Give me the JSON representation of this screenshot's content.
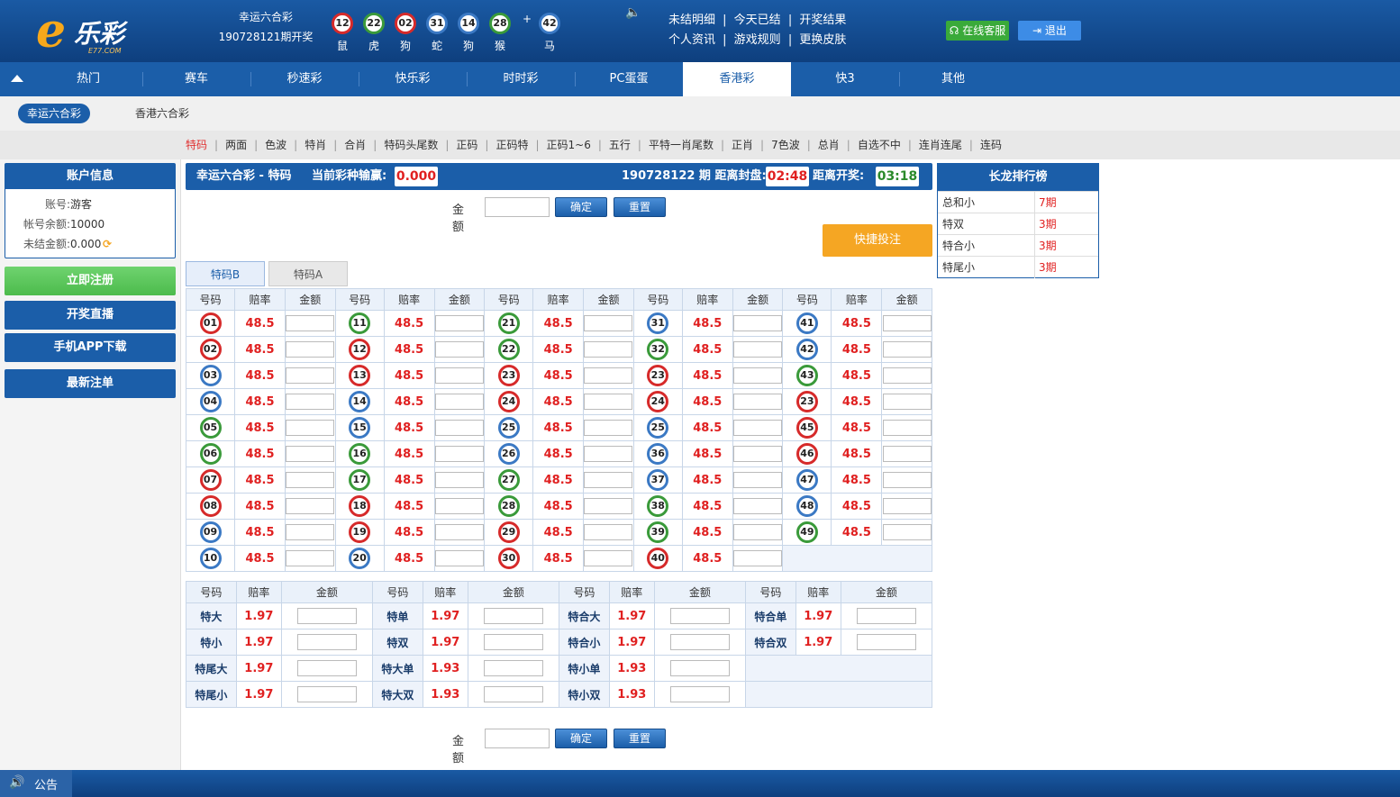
{
  "header": {
    "logo_e": "e",
    "logo_text": "乐彩",
    "logo_sub": "E77.COM",
    "lottery_name": "幸运六合彩",
    "period_text": "190728121期开奖",
    "draw": [
      {
        "num": "12",
        "zodiac": "鼠",
        "color": "red"
      },
      {
        "num": "22",
        "zodiac": "虎",
        "color": "green"
      },
      {
        "num": "02",
        "zodiac": "狗",
        "color": "red"
      },
      {
        "num": "31",
        "zodiac": "蛇",
        "color": "blue"
      },
      {
        "num": "14",
        "zodiac": "狗",
        "color": "blue"
      },
      {
        "num": "28",
        "zodiac": "猴",
        "color": "green"
      },
      {
        "num": "42",
        "zodiac": "马",
        "color": "blue"
      }
    ],
    "plus": "+",
    "links_row1": [
      "未结明细",
      "今天已结",
      "开奖结果"
    ],
    "links_row2": [
      "个人资讯",
      "游戏规则",
      "更换皮肤"
    ],
    "service_btn": "在线客服",
    "logout_btn": "退出"
  },
  "nav": {
    "items": [
      "热门",
      "赛车",
      "秒速彩",
      "快乐彩",
      "时时彩",
      "PC蛋蛋",
      "香港彩",
      "快3",
      "其他"
    ],
    "active": 6
  },
  "subtabs": [
    "幸运六合彩",
    "香港六合彩"
  ],
  "bet_types": [
    "特码",
    "两面",
    "色波",
    "特肖",
    "合肖",
    "特码头尾数",
    "正码",
    "正码特",
    "正码1~6",
    "五行",
    "平特一肖尾数",
    "正肖",
    "7色波",
    "总肖",
    "自选不中",
    "连肖连尾",
    "连码"
  ],
  "account": {
    "title": "账户信息",
    "rows": [
      {
        "k": "账号:",
        "v": "游客"
      },
      {
        "k": "帐号余额:",
        "v": "10000"
      },
      {
        "k": "未结金额:",
        "v": "0.000"
      }
    ]
  },
  "left_buttons": [
    "立即注册",
    "开奖直播",
    "手机APP下载",
    "最新注单"
  ],
  "main": {
    "title": "幸运六合彩 - 特码",
    "pl_label": "当前彩种输赢:",
    "pl_value": "0.000",
    "period": "190728122 期 距离封盘:",
    "close_time": "02:48",
    "open_label": "距离开奖:",
    "open_time": "03:18",
    "amount_label": "金额",
    "confirm": "确定",
    "reset": "重置",
    "quick_bet": "快捷投注",
    "tabs": [
      "特码B",
      "特码A"
    ],
    "col_headers": [
      "号码",
      "赔率",
      "金额"
    ],
    "odds": "48.5"
  },
  "numbers": [
    [
      "01",
      "red"
    ],
    [
      "02",
      "red"
    ],
    [
      "03",
      "blue"
    ],
    [
      "04",
      "blue"
    ],
    [
      "05",
      "green"
    ],
    [
      "06",
      "green"
    ],
    [
      "07",
      "red"
    ],
    [
      "08",
      "red"
    ],
    [
      "09",
      "blue"
    ],
    [
      "10",
      "blue"
    ],
    [
      "11",
      "green"
    ],
    [
      "12",
      "red"
    ],
    [
      "13",
      "red"
    ],
    [
      "14",
      "blue"
    ],
    [
      "15",
      "blue"
    ],
    [
      "16",
      "green"
    ],
    [
      "17",
      "green"
    ],
    [
      "18",
      "red"
    ],
    [
      "19",
      "red"
    ],
    [
      "20",
      "blue"
    ],
    [
      "21",
      "green"
    ],
    [
      "22",
      "green"
    ],
    [
      "23",
      "red"
    ],
    [
      "24",
      "red"
    ],
    [
      "25",
      "blue"
    ],
    [
      "26",
      "blue"
    ],
    [
      "27",
      "green"
    ],
    [
      "28",
      "green"
    ],
    [
      "29",
      "red"
    ],
    [
      "30",
      "red"
    ],
    [
      "31",
      "blue"
    ],
    [
      "32",
      "green"
    ],
    [
      "23",
      "red"
    ],
    [
      "24",
      "red"
    ],
    [
      "25",
      "blue"
    ],
    [
      "36",
      "blue"
    ],
    [
      "37",
      "blue"
    ],
    [
      "38",
      "green"
    ],
    [
      "39",
      "green"
    ],
    [
      "40",
      "red"
    ],
    [
      "41",
      "blue"
    ],
    [
      "42",
      "blue"
    ],
    [
      "43",
      "green"
    ],
    [
      "23",
      "red"
    ],
    [
      "45",
      "red"
    ],
    [
      "46",
      "red"
    ],
    [
      "47",
      "blue"
    ],
    [
      "48",
      "blue"
    ],
    [
      "49",
      "green"
    ]
  ],
  "two_sides": {
    "headers": [
      "号码",
      "赔率",
      "金额"
    ],
    "rows": [
      [
        {
          "n": "特大",
          "o": "1.97"
        },
        {
          "n": "特单",
          "o": "1.97"
        },
        {
          "n": "特合大",
          "o": "1.97"
        },
        {
          "n": "特合单",
          "o": "1.97"
        }
      ],
      [
        {
          "n": "特小",
          "o": "1.97"
        },
        {
          "n": "特双",
          "o": "1.97"
        },
        {
          "n": "特合小",
          "o": "1.97"
        },
        {
          "n": "特合双",
          "o": "1.97"
        }
      ],
      [
        {
          "n": "特尾大",
          "o": "1.97"
        },
        {
          "n": "特大单",
          "o": "1.93"
        },
        {
          "n": "特小单",
          "o": "1.93"
        }
      ],
      [
        {
          "n": "特尾小",
          "o": "1.97"
        },
        {
          "n": "特大双",
          "o": "1.93"
        },
        {
          "n": "特小双",
          "o": "1.93"
        }
      ]
    ]
  },
  "rank": {
    "title": "长龙排行榜",
    "rows": [
      {
        "k": "总和小",
        "v": "7期"
      },
      {
        "k": "特双",
        "v": "3期"
      },
      {
        "k": "特合小",
        "v": "3期"
      },
      {
        "k": "特尾小",
        "v": "3期"
      }
    ]
  },
  "footer": {
    "notice": "公告"
  },
  "colors": {
    "primary": "#1b5ea9",
    "red": "#e02020",
    "orange": "#f5a623",
    "green": "#3aaa3a"
  }
}
